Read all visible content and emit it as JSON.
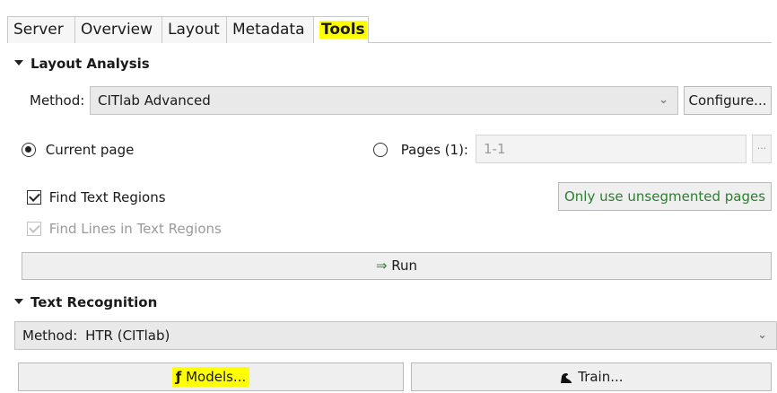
{
  "tabs": [
    "Server",
    "Overview",
    "Layout",
    "Metadata",
    "Tools"
  ],
  "active_tab": "Tools",
  "layout_analysis": {
    "heading": "Layout Analysis",
    "method_label": "Method:",
    "method_value": "CITlab Advanced",
    "configure_label": "Configure...",
    "current_page_label": "Current page",
    "pages_label": "Pages (1):",
    "pages_value": "1-1",
    "pages_browse": "...",
    "find_text_regions": "Find Text Regions",
    "find_lines": "Find Lines in Text Regions",
    "only_unsegmented": "Only use unsegmented pages",
    "run_label": "Run",
    "run_icon": "⇒"
  },
  "text_recognition": {
    "heading": "Text Recognition",
    "method_label": "Method:",
    "method_value": "HTR (CITlab)",
    "models_label": "Models...",
    "models_icon": "ƒ",
    "train_label": "Train..."
  },
  "colors": {
    "highlight": "#ffff00",
    "green_text": "#2e7d32"
  }
}
